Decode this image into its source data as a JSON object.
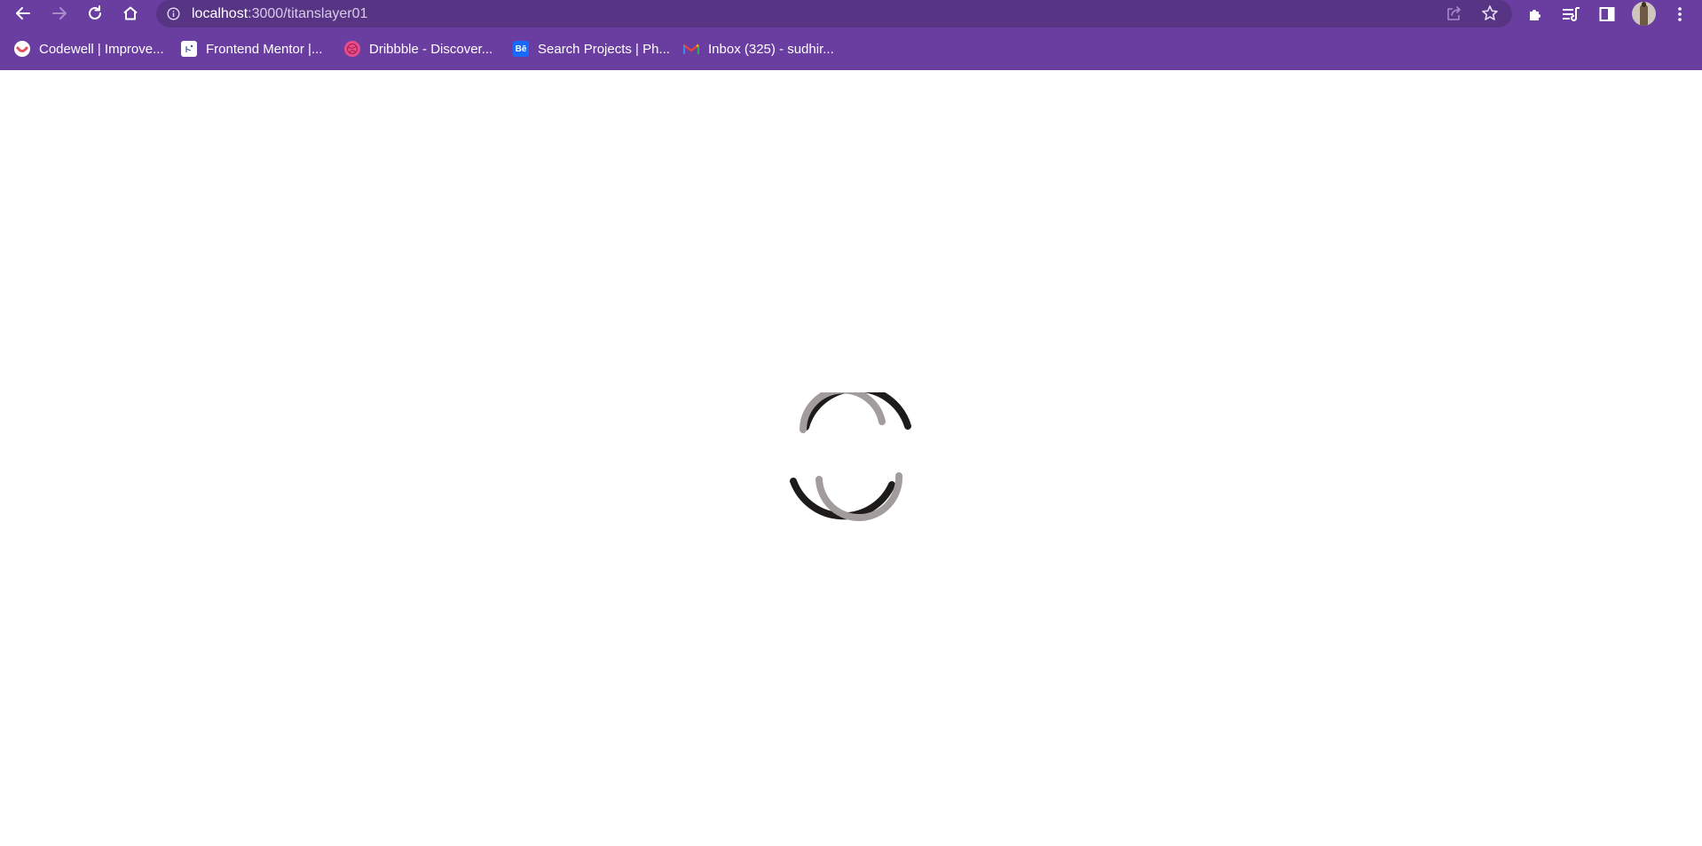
{
  "browser": {
    "url_host": "localhost",
    "url_path": ":3000/titanslayer01",
    "toolbar": {
      "back_icon": "arrow-left-icon",
      "forward_icon": "arrow-right-icon",
      "reload_icon": "reload-icon",
      "home_icon": "home-icon",
      "info_icon": "info-icon",
      "share_icon": "share-icon",
      "bookmark_star_icon": "star-icon",
      "extensions_icon": "puzzle-icon",
      "reading_list_icon": "reading-list-icon",
      "side_panel_icon": "side-panel-icon",
      "menu_icon": "kebab-menu-icon"
    },
    "bookmarks": [
      {
        "label": "Codewell | Improve...",
        "icon": "codewell-icon",
        "color": "#e8505b"
      },
      {
        "label": "Frontend Mentor |...",
        "icon": "frontend-mentor-icon",
        "color": "#ffffff"
      },
      {
        "label": "Dribbble - Discover...",
        "icon": "dribbble-icon",
        "color": "#ea4c89"
      },
      {
        "label": "Search Projects | Ph...",
        "icon": "behance-icon",
        "color": "#1769ff"
      },
      {
        "label": "Inbox (325) - sudhir...",
        "icon": "gmail-icon",
        "color": "#ea4335"
      }
    ]
  },
  "page": {
    "state": "loading",
    "spinner_icon": "loading-spinner-icon"
  },
  "colors": {
    "chrome_bg": "#6a3ea1",
    "omnibox_bg": "#573584",
    "spinner_dark": "#1e1b1b",
    "spinner_light": "#a39c9c"
  }
}
